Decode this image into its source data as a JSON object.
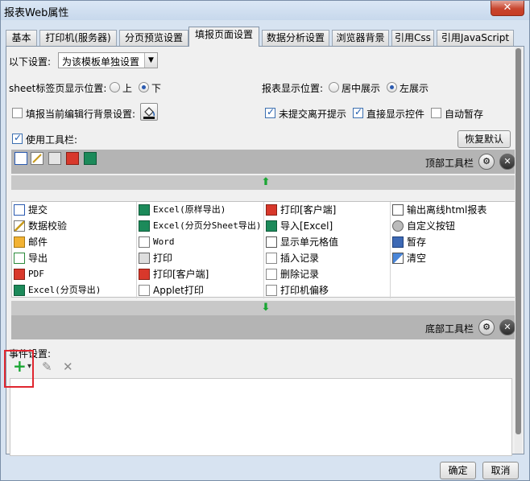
{
  "window": {
    "title": "报表Web属性",
    "close_glyph": "✕"
  },
  "tabs": [
    {
      "label": "基本",
      "active": false
    },
    {
      "label": "打印机(服务器)",
      "active": false
    },
    {
      "label": "分页预览设置",
      "active": false
    },
    {
      "label": "填报页面设置",
      "active": true
    },
    {
      "label": "数据分析设置",
      "active": false
    },
    {
      "label": "浏览器背景",
      "active": false
    },
    {
      "label": "引用Css",
      "active": false
    },
    {
      "label": "引用JavaScript",
      "active": false
    }
  ],
  "settings": {
    "scope_label": "以下设置:",
    "scope_value": "为该模板单独设置",
    "sheet_label": "sheet标签页显示位置:",
    "sheet_options": {
      "top": "上",
      "bottom": "下",
      "selected": "bottom"
    },
    "report_label": "报表显示位置:",
    "report_options": {
      "center": "居中展示",
      "left": "左展示",
      "selected": "left"
    },
    "fill_bg_label": "填报当前编辑行背景设置:",
    "fill_bg_checked": false,
    "unsubmitted_label": "未提交离开提示",
    "unsubmitted_checked": true,
    "direct_control_label": "直接显示控件",
    "direct_control_checked": true,
    "autosave_label": "自动暂存",
    "autosave_checked": false,
    "use_toolbar_label": "使用工具栏:",
    "use_toolbar_checked": true,
    "restore_default": "恢复默认"
  },
  "toolbars": {
    "top_label": "顶部工具栏",
    "bottom_label": "底部工具栏",
    "up_arrow": "⬆",
    "down_arrow": "⬇",
    "gear_glyph": "⚙",
    "close_glyph": "✕"
  },
  "tool_items": [
    [
      {
        "label": "提交",
        "icon": "submit-icon",
        "mono": false
      },
      {
        "label": "Excel(原样导出)",
        "icon": "excel-icon",
        "mono": true
      },
      {
        "label": "打印[客户端]",
        "icon": "pdf-print-icon",
        "mono": false
      },
      {
        "label": "输出离线html报表",
        "icon": "html-export-icon",
        "mono": false
      }
    ],
    [
      {
        "label": "数据校验",
        "icon": "verify-icon",
        "mono": false
      },
      {
        "label": "Excel(分页分Sheet导出)",
        "icon": "excel-icon",
        "mono": true
      },
      {
        "label": "导入[Excel]",
        "icon": "import-excel-icon",
        "mono": false
      },
      {
        "label": "自定义按钮",
        "icon": "gear-icon",
        "mono": false
      }
    ],
    [
      {
        "label": "邮件",
        "icon": "mail-icon",
        "mono": false
      },
      {
        "label": "Word",
        "icon": "word-icon",
        "mono": true
      },
      {
        "label": "显示单元格值",
        "icon": "cell-value-icon",
        "mono": false
      },
      {
        "label": "暂存",
        "icon": "save-icon",
        "mono": false
      }
    ],
    [
      {
        "label": "导出",
        "icon": "export-icon",
        "mono": false
      },
      {
        "label": "打印",
        "icon": "printer-icon",
        "mono": false
      },
      {
        "label": "插入记录",
        "icon": "insert-row-icon",
        "mono": false
      },
      {
        "label": "清空",
        "icon": "eraser-icon",
        "mono": false
      }
    ],
    [
      {
        "label": "PDF",
        "icon": "pdf-icon",
        "mono": true
      },
      {
        "label": "打印[客户端]",
        "icon": "flash-print-icon",
        "mono": false
      },
      {
        "label": "删除记录",
        "icon": "delete-row-icon",
        "mono": false
      },
      {
        "label": "",
        "icon": "",
        "mono": false
      }
    ],
    [
      {
        "label": "Excel(分页导出)",
        "icon": "excel-icon",
        "mono": true
      },
      {
        "label": "Applet打印",
        "icon": "applet-print-icon",
        "mono": false
      },
      {
        "label": "打印机偏移",
        "icon": "move-icon",
        "mono": false
      },
      {
        "label": "",
        "icon": "",
        "mono": false
      }
    ]
  ],
  "events": {
    "label": "事件设置:",
    "add_glyph": "+",
    "add_dropdown_glyph": "▾",
    "edit_glyph": "✎",
    "delete_glyph": "✕"
  },
  "footer": {
    "ok": "确定",
    "cancel": "取消"
  },
  "colors": {
    "highlight": "#e0262f",
    "accent": "#2a5ab0",
    "add_green": "#1aa633"
  }
}
